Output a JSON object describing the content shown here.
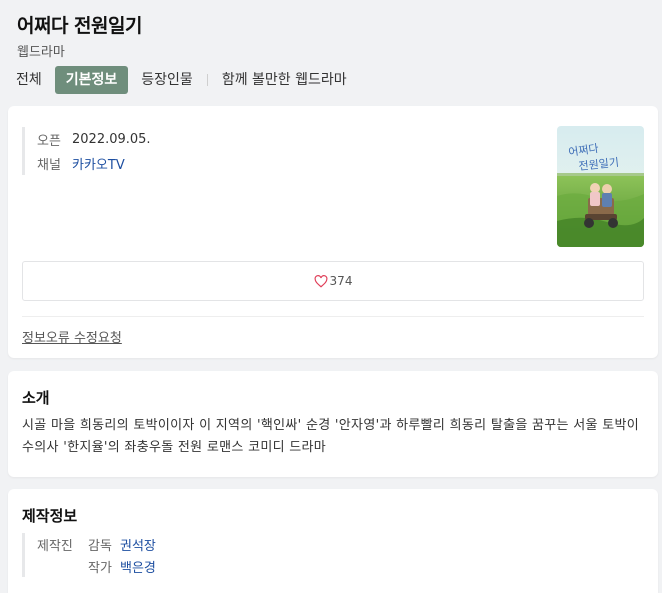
{
  "header": {
    "title": "어쩌다 전원일기",
    "subtitle": "웹드라마",
    "tabs": [
      {
        "label": "전체"
      },
      {
        "label": "기본정보"
      },
      {
        "label": "등장인물"
      },
      {
        "label": "함께 볼만한 웹드라마"
      }
    ]
  },
  "basic_info": {
    "rows": [
      {
        "key": "오픈",
        "value": "2022.09.05."
      },
      {
        "key": "채널",
        "value": "카카오TV"
      }
    ],
    "poster_text": "어쩌다 전원일기",
    "like_count": "374",
    "report_label": "정보오류 수정요청"
  },
  "intro": {
    "title": "소개",
    "text": "시골 마을 희동리의 토박이이자 이 지역의 '핵인싸' 순경 '안자영'과 하루빨리 희동리 탈출을 꿈꾸는 서울 토박이 수의사 '한지율'의 좌충우돌 전원 로맨스 코미디 드라마"
  },
  "production": {
    "title": "제작정보",
    "group": "제작진",
    "credits": [
      {
        "role": "감독",
        "name": "권석장"
      },
      {
        "role": "작가",
        "name": "백은경"
      }
    ]
  },
  "colors": {
    "active_tab": "#6f8e7c",
    "link": "#1e4fa1",
    "heart": "#e0405a"
  }
}
